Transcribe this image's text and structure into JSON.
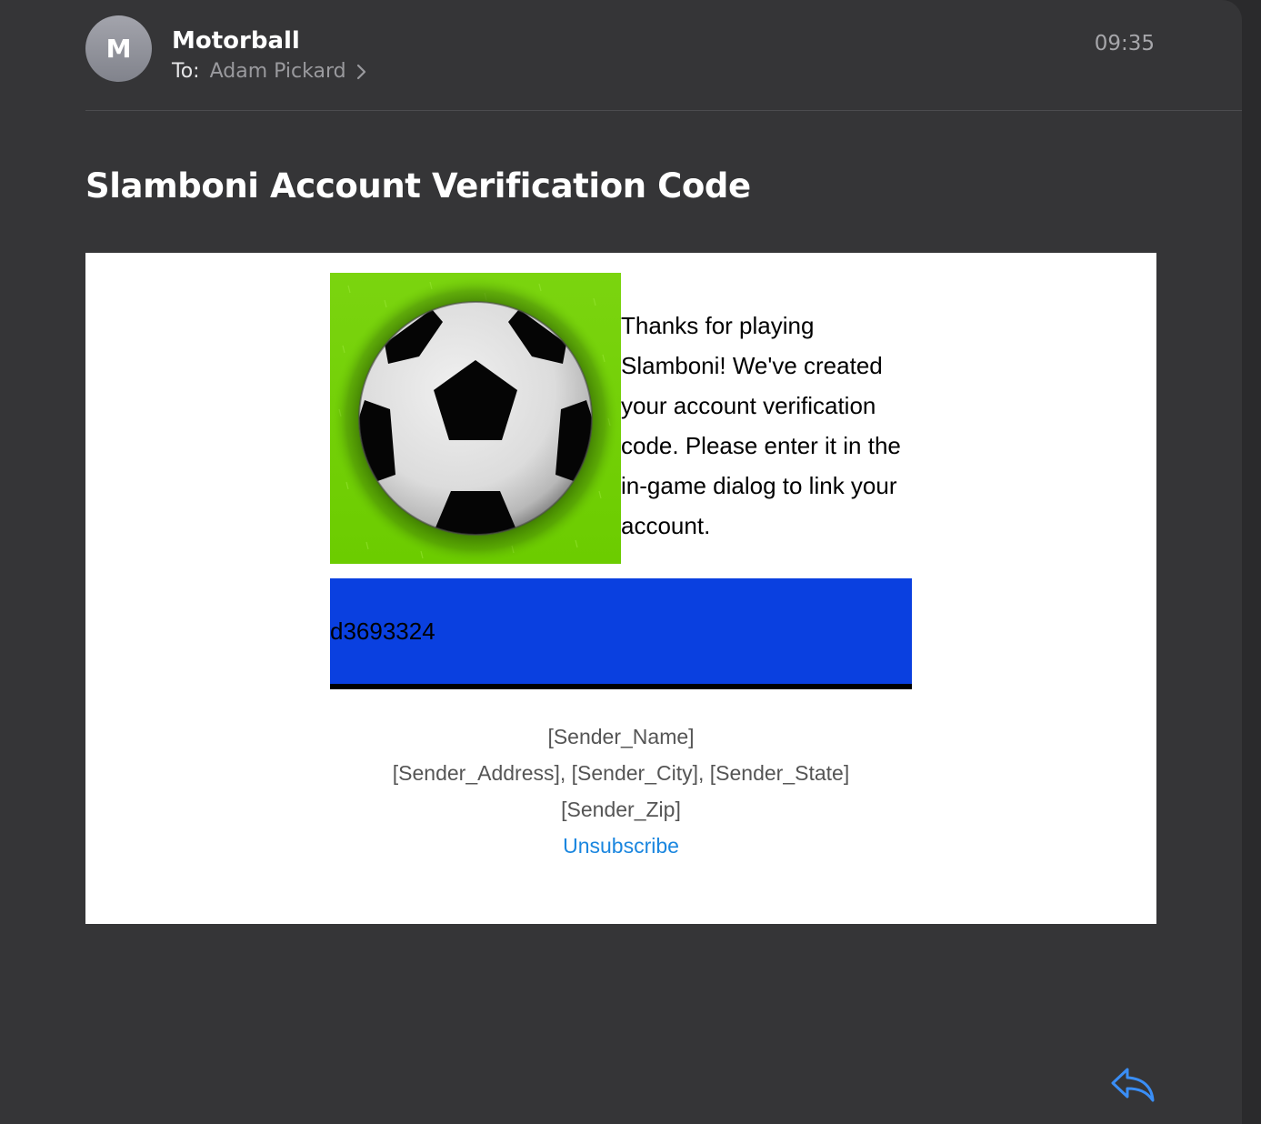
{
  "header": {
    "avatar_letter": "M",
    "sender": "Motorball",
    "to_label": "To:",
    "recipient": "Adam Pickard",
    "time": "09:35"
  },
  "subject": "Slamboni Account Verification Code",
  "body": {
    "intro_text": "Thanks for playing Slamboni!  We've created your account verification code.  Please enter it in the in-game dialog to link your account.",
    "code": "d3693324",
    "code_box_color": "#0a40e0",
    "footer": {
      "sender_name": "[Sender_Name]",
      "sender_address": "[Sender_Address], [Sender_City], [Sender_State]",
      "sender_zip": "[Sender_Zip]",
      "unsubscribe": "Unsubscribe"
    }
  },
  "icons": {
    "reply": "reply-arrow-icon",
    "chevron": "chevron-right-icon",
    "image": "soccer-ball-image"
  },
  "colors": {
    "background": "#353537",
    "link": "#1a86df",
    "accent": "#3a8ef6"
  }
}
